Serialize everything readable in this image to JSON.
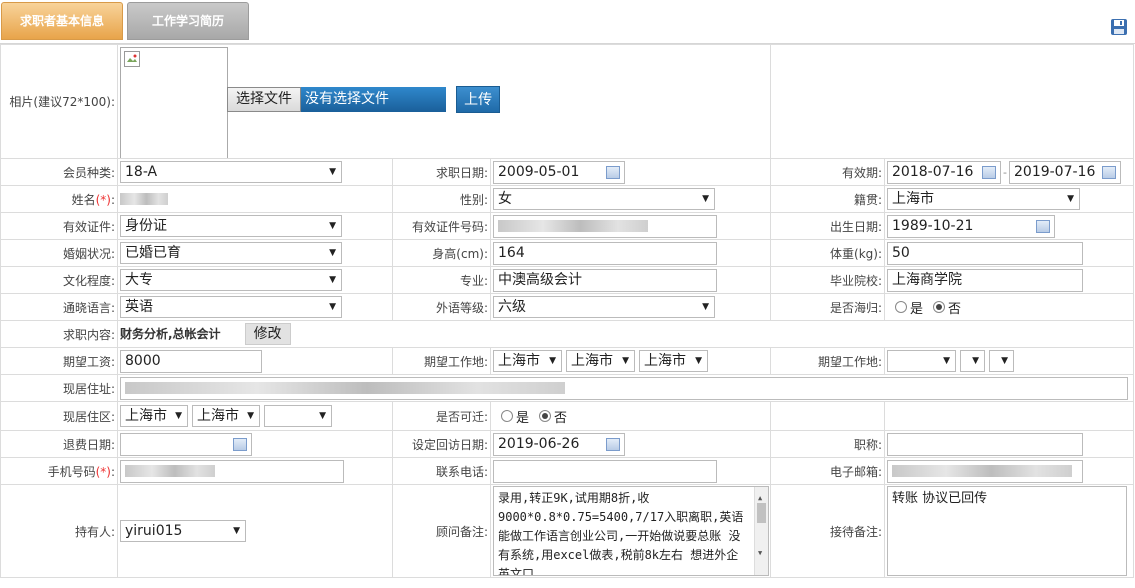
{
  "tabs": [
    {
      "label": "求职者基本信息"
    },
    {
      "label": "工作学习简历"
    }
  ],
  "photo": {
    "label": "相片(建议72*100):",
    "choose_button": "选择文件",
    "no_file": "没有选择文件",
    "upload_button": "上传"
  },
  "row1": {
    "member_label": "会员种类:",
    "member_value": "18-A",
    "job_date_label": "求职日期:",
    "job_date_value": "2009-05-01",
    "valid_label": "有效期:",
    "valid_from": "2018-07-16",
    "valid_sep": "-",
    "valid_to": "2019-07-16"
  },
  "row2": {
    "name_label": "姓名",
    "required": "(*)",
    "name_colon": ":",
    "gender_label": "性别:",
    "gender_value": "女",
    "origin_label": "籍贯:",
    "origin_value": "上海市"
  },
  "row3": {
    "id_label": "有效证件:",
    "id_value": "身份证",
    "id_no_label": "有效证件号码:",
    "birth_label": "出生日期:",
    "birth_value": "1989-10-21"
  },
  "row4": {
    "marital_label": "婚姻状况:",
    "marital_value": "已婚已育",
    "height_label": "身高(cm):",
    "height_value": "164",
    "weight_label": "体重(kg):",
    "weight_value": "50"
  },
  "row5": {
    "edu_label": "文化程度:",
    "edu_value": "大专",
    "major_label": "专业:",
    "major_value": "中澳高级会计",
    "school_label": "毕业院校:",
    "school_value": "上海商学院"
  },
  "row6": {
    "lang_label": "通晓语言:",
    "lang_value": "英语",
    "level_label": "外语等级:",
    "level_value": "六级",
    "returnee_label": "是否海归:",
    "yes": "是",
    "no": "否"
  },
  "row7": {
    "content_label": "求职内容:",
    "content_value": "财务分析,总帐会计",
    "modify_button": "修改"
  },
  "row8": {
    "salary_label": "期望工资:",
    "salary_value": "8000",
    "place_label": "期望工作地:",
    "place1": "上海市",
    "place2": "上海市",
    "place3": "上海市",
    "place2_label": "期望工作地:"
  },
  "row9": {
    "address_label": "现居住址:"
  },
  "row10": {
    "district_label": "现居住区:",
    "d1": "上海市",
    "d2": "上海市",
    "relocate_label": "是否可迁:",
    "yes": "是",
    "no": "否"
  },
  "row11": {
    "refund_label": "退费日期:",
    "visit_label": "设定回访日期:",
    "visit_value": "2019-06-26",
    "title_label": "职称:"
  },
  "row12": {
    "mobile_label": "手机号码",
    "required": "(*)",
    "colon": ":",
    "phone_label": "联系电话:",
    "email_label": "电子邮箱:"
  },
  "row13": {
    "holder_label": "持有人:",
    "holder_value": "yirui015",
    "advisor_note_label": "顾问备注:",
    "advisor_note": "录用,转正9K,试用期8折,收9000*0.8*0.75=5400,7/17入职离职,英语能做工作语言创业公司,一开始做说要总账 没有系统,用excel做表,税前8k左右 想进外企 英文口",
    "reception_label": "接待备注:",
    "reception_note": "转账 协议已回传"
  }
}
